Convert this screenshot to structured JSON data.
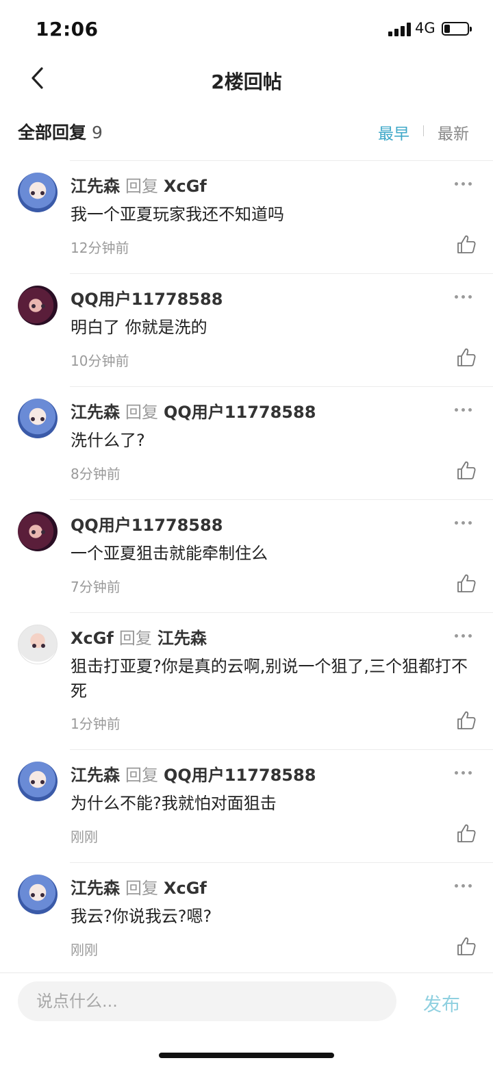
{
  "status_bar": {
    "time": "12:06",
    "network": "4G"
  },
  "nav": {
    "title": "2楼回帖"
  },
  "replies_header": {
    "title": "全部回复",
    "count": "9",
    "sort_earliest": "最早",
    "sort_latest": "最新"
  },
  "replies": [
    {
      "author": "江先森",
      "reply_word": "回复",
      "target": "XcGf",
      "text": "我一个亚夏玩家我还不知道吗",
      "time": "12分钟前",
      "avatar": "blue-hair-avatar"
    },
    {
      "author": "QQ用户11778588",
      "reply_word": "",
      "target": "",
      "text": "明白了 你就是洗的",
      "time": "10分钟前",
      "avatar": "purple-hair-avatar"
    },
    {
      "author": "江先森",
      "reply_word": "回复",
      "target": "QQ用户11778588",
      "text": "洗什么了?",
      "time": "8分钟前",
      "avatar": "blue-hair-avatar"
    },
    {
      "author": "QQ用户11778588",
      "reply_word": "",
      "target": "",
      "text": "一个亚夏狙击就能牵制住么",
      "time": "7分钟前",
      "avatar": "purple-hair-avatar"
    },
    {
      "author": "XcGf",
      "reply_word": "回复",
      "target": "江先森",
      "text": "狙击打亚夏?你是真的云啊,别说一个狙了,三个狙都打不死",
      "time": "1分钟前",
      "avatar": "white-hair-avatar"
    },
    {
      "author": "江先森",
      "reply_word": "回复",
      "target": "QQ用户11778588",
      "text": "为什么不能?我就怕对面狙击",
      "time": "刚刚",
      "avatar": "blue-hair-avatar"
    },
    {
      "author": "江先森",
      "reply_word": "回复",
      "target": "XcGf",
      "text": "我云?你说我云?嗯?",
      "time": "刚刚",
      "avatar": "blue-hair-avatar"
    }
  ],
  "bottom": {
    "input_placeholder": "说点什么...",
    "publish_label": "发布"
  },
  "colors": {
    "accent": "#3fa8c8",
    "publish_disabled": "#8fd0e0",
    "muted": "#9a9a9a"
  }
}
